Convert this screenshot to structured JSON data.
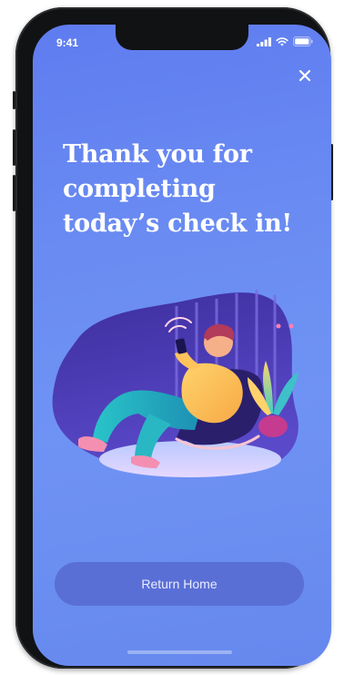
{
  "status_bar": {
    "time": "9:41",
    "icons": [
      "signal-icon",
      "wifi-icon",
      "battery-icon"
    ]
  },
  "close_icon": "close-icon",
  "headline": "Thank you for completing today’s check in!",
  "illustration": "person-relaxing-with-phone-illustration",
  "cta": {
    "label": "Return Home"
  },
  "colors": {
    "background": "#6a8cf2",
    "button": "#5a6fd6",
    "text": "#ffffff"
  }
}
